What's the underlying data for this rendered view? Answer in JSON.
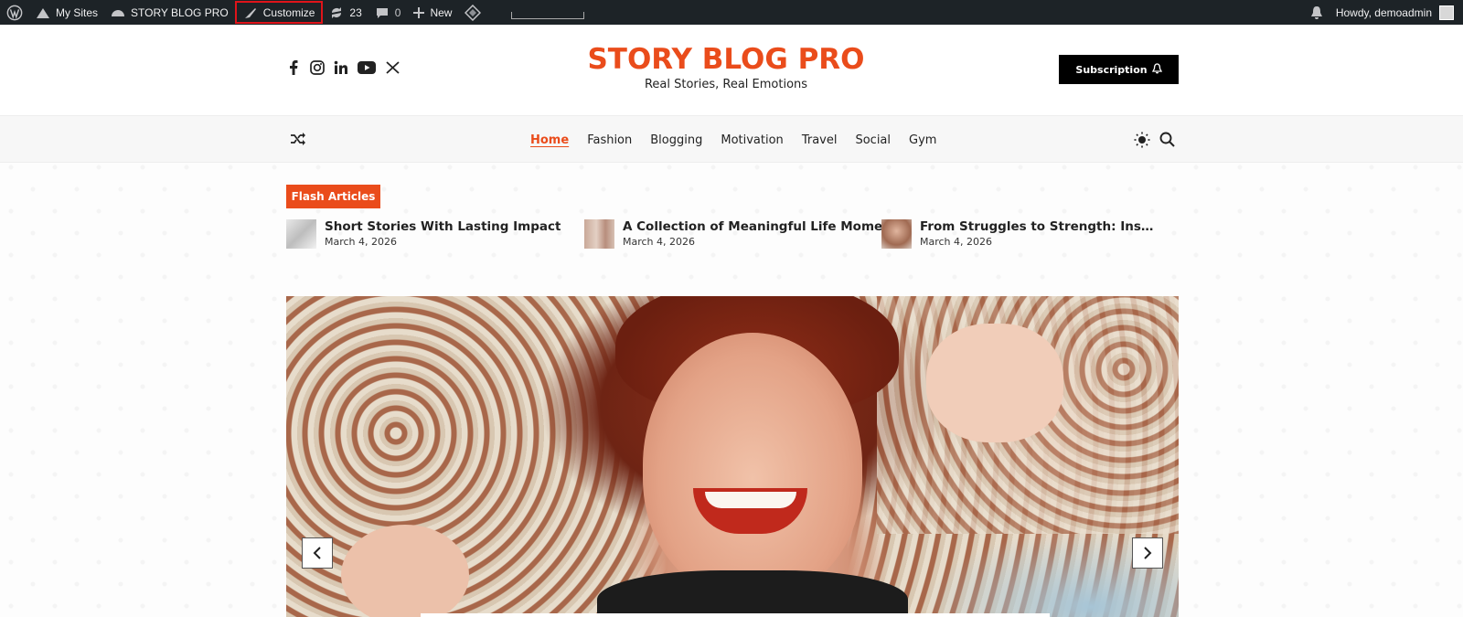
{
  "admin_bar": {
    "my_sites": "My Sites",
    "site_name": "STORY BLOG PRO",
    "customize": "Customize",
    "updates_count": "23",
    "comments_count": "0",
    "new": "New",
    "howdy": "Howdy, demoadmin"
  },
  "header": {
    "site_title": "STORY BLOG PRO",
    "tagline": "Real Stories, Real Emotions",
    "subscription": "Subscription",
    "social_icons": [
      "facebook-icon",
      "instagram-icon",
      "linkedin-icon",
      "youtube-icon",
      "x-icon"
    ]
  },
  "nav": {
    "items": [
      {
        "label": "Home",
        "active": true
      },
      {
        "label": "Fashion"
      },
      {
        "label": "Blogging"
      },
      {
        "label": "Motivation"
      },
      {
        "label": "Travel"
      },
      {
        "label": "Social"
      },
      {
        "label": "Gym"
      }
    ]
  },
  "flash": {
    "label": "Flash Articles",
    "articles": [
      {
        "title": "Short Stories With Lasting Impact",
        "date": "March 4, 2026"
      },
      {
        "title": "A Collection of Meaningful Life Moments",
        "date": "March 4, 2026"
      },
      {
        "title": "From Struggles to Strength: Inspiring…",
        "date": "March 4, 2026"
      }
    ]
  },
  "colors": {
    "accent": "#ea4c1b",
    "admin_bar": "#1d2327"
  }
}
